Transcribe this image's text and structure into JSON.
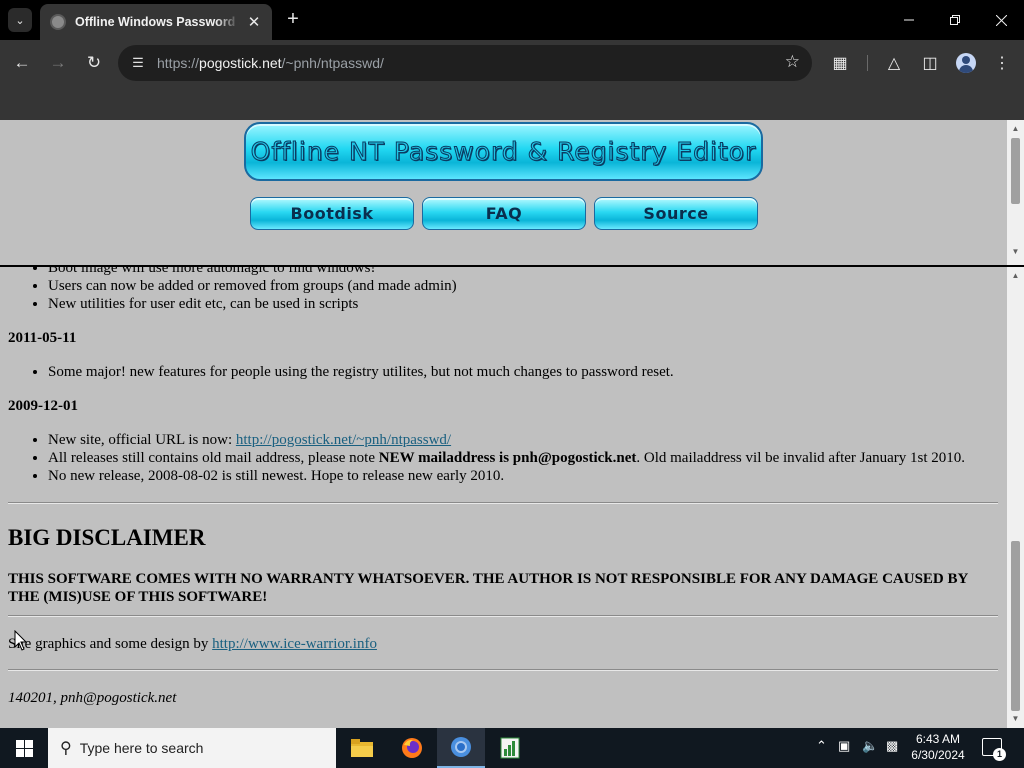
{
  "browser": {
    "tab": {
      "title": "Offline Windows Password & Registry Editor"
    },
    "url": {
      "scheme": "https://",
      "host": "pogostick.net",
      "path": "/~pnh/ntpasswd/"
    }
  },
  "site": {
    "banner_title": "Offline NT Password & Registry Editor",
    "nav": [
      {
        "label": "Bootdisk"
      },
      {
        "label": "FAQ"
      },
      {
        "label": "Source"
      }
    ]
  },
  "news": {
    "top_items": [
      "Boot image will use more automagic to find windows!",
      "Users can now be added or removed from groups (and made admin)",
      "New utilities for user edit etc, can be used in scripts"
    ],
    "entries": [
      {
        "date": "2011-05-11",
        "items": [
          "Some major! new features for people using the registry utilites, but not much changes to password reset."
        ]
      },
      {
        "date": "2009-12-01",
        "item1_prefix": "New site, official URL is now: ",
        "item1_link": "http://pogostick.net/~pnh/ntpasswd/",
        "item2_prefix": "All releases still contains old mail address, please note ",
        "item2_bold": "NEW mailaddress is pnh@pogostick.net",
        "item2_suffix": ". Old mailaddress vil be invalid after January 1st 2010.",
        "item3": "No new release, 2008-08-02 is still newest. Hope to release new early 2010."
      }
    ]
  },
  "disclaimer": {
    "heading": "BIG DISCLAIMER",
    "text": "THIS SOFTWARE COMES WITH NO WARRANTY WHATSOEVER. THE AUTHOR IS NOT RESPONSIBLE FOR ANY DAMAGE CAUSED BY THE (MIS)USE OF THIS SOFTWARE!"
  },
  "credits": {
    "prefix": "Site graphics and some design by ",
    "link": "http://www.ice-warrior.info"
  },
  "signature": "140201, pnh@pogostick.net",
  "taskbar": {
    "search_placeholder": "Type here to search",
    "time": "6:43 AM",
    "date": "6/30/2024",
    "notification_count": "1"
  },
  "colors": {
    "page_bg": "#c0c0c0",
    "link": "#1a6080",
    "banner_cyan": "#22d8f2",
    "browser_chrome": "#353535"
  }
}
